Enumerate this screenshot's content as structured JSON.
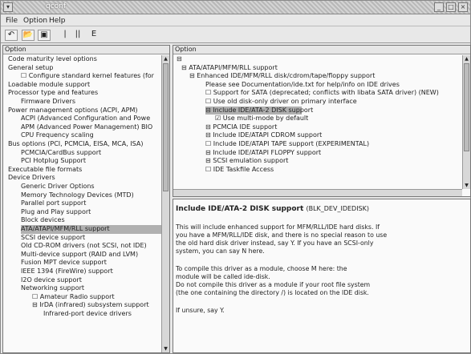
{
  "window": {
    "title": "qconf"
  },
  "menu": [
    "File",
    "Option",
    "Help"
  ],
  "left_panel": {
    "header": "Option",
    "items": [
      {
        "text": "Code maturity level options"
      },
      {
        "text": "General setup"
      },
      {
        "text": "☐ Configure standard kernel features (for"
      },
      {
        "text": "Loadable module support"
      },
      {
        "text": "Processor type and features"
      },
      {
        "text": "Firmware Drivers"
      },
      {
        "text": "Power management options (ACPI, APM)"
      },
      {
        "text": "ACPI (Advanced Configuration and Powe"
      },
      {
        "text": "APM (Advanced Power Management) BIO"
      },
      {
        "text": "CPU Frequency scaling"
      },
      {
        "text": "Bus options (PCI, PCMCIA, EISA, MCA, ISA)"
      },
      {
        "text": "PCMCIA/CardBus support"
      },
      {
        "text": "PCI Hotplug Support"
      },
      {
        "text": "Executable file formats"
      },
      {
        "text": "Device Drivers"
      },
      {
        "text": "Generic Driver Options"
      },
      {
        "text": "Memory Technology Devices (MTD)"
      },
      {
        "text": "Parallel port support"
      },
      {
        "text": "Plug and Play support"
      },
      {
        "text": "Block devices"
      },
      {
        "text": "ATA/ATAPI/MFM/RLL support"
      },
      {
        "text": "SCSI device support"
      },
      {
        "text": "Old CD-ROM drivers (not SCSI, not IDE)"
      },
      {
        "text": "Multi-device support (RAID and LVM)"
      },
      {
        "text": "Fusion MPT device support"
      },
      {
        "text": "IEEE 1394 (FireWire) support"
      },
      {
        "text": "I2O device support"
      },
      {
        "text": "Networking support"
      },
      {
        "text": "☐ Amateur Radio support"
      },
      {
        "text": "⊟ IrDA (infrared) subsystem support"
      },
      {
        "text": "Infrared-port device drivers"
      }
    ]
  },
  "right_panel": {
    "header": "Option",
    "items": [
      {
        "text": "⊟ ATA/ATAPI/MFM/RLL support"
      },
      {
        "text": "⊟ Enhanced IDE/MFM/RLL disk/cdrom/tape/floppy support"
      },
      {
        "text": "Please see Documentation/ide.txt for help/info on IDE drives"
      },
      {
        "text": "☐ Support for SATA (deprecated; conflicts with libata SATA driver) (NEW)"
      },
      {
        "text": "☐ Use old disk-only driver on primary interface"
      },
      {
        "text": "⊟ Include IDE/ATA-2 DISK support"
      },
      {
        "text": "☑ Use multi-mode by default"
      },
      {
        "text": "⊟ PCMCIA IDE support"
      },
      {
        "text": "⊟ Include IDE/ATAPI CDROM support"
      },
      {
        "text": "☐ Include IDE/ATAPI TAPE support (EXPERIMENTAL)"
      },
      {
        "text": "⊟ Include IDE/ATAPI FLOPPY support"
      },
      {
        "text": "⊟ SCSI emulation support"
      },
      {
        "text": "☐ IDE Taskfile Access"
      }
    ]
  },
  "help": {
    "title": "Include IDE/ATA-2 DISK support",
    "symbol": "(BLK_DEV_IDEDISK)",
    "lines": [
      "This will include enhanced support for MFM/RLL/IDE hard disks. If",
      "you have a MFM/RLL/IDE disk, and there is no special reason to use",
      "the old hard disk driver instead, say Y. If you have an SCSI-only",
      "system, you can say N here.",
      "",
      "To compile this driver as a module, choose M here: the",
      "module will be called ide-disk.",
      "Do not compile this driver as a module if your root file system",
      "(the one containing the directory /) is located on the IDE disk.",
      "",
      "If unsure, say Y."
    ]
  }
}
